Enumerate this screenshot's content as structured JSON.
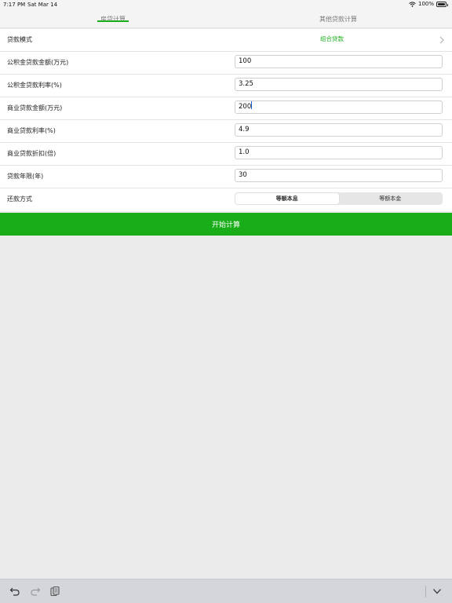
{
  "status_bar": {
    "time": "7:17 PM",
    "date": "Sat Mar 14",
    "battery": "100%"
  },
  "tabs": [
    {
      "label": "房贷计算",
      "active": true
    },
    {
      "label": "其他贷款计算",
      "active": false
    }
  ],
  "accent_color": "#19ad19",
  "form": {
    "loan_mode": {
      "label": "贷款模式",
      "value": "组合贷款"
    },
    "fields": [
      {
        "label": "公积金贷款金额(万元)",
        "value": "100"
      },
      {
        "label": "公积金贷款利率(%)",
        "value": "3.25"
      },
      {
        "label": "商业贷款金额(万元)",
        "value": "200"
      },
      {
        "label": "商业贷款利率(%)",
        "value": "4.9"
      },
      {
        "label": "商业贷款折扣(倍)",
        "value": "1.0"
      },
      {
        "label": "贷款年限(年)",
        "value": "30"
      }
    ],
    "repayment": {
      "label": "还款方式",
      "options": [
        "等额本息",
        "等额本金"
      ],
      "selected": "等额本息"
    }
  },
  "calculate_button": "开始计算",
  "keyboard_toolbar": {
    "icons": [
      "undo-icon",
      "redo-icon",
      "paste-icon",
      "keyboard-dismiss-icon"
    ]
  }
}
